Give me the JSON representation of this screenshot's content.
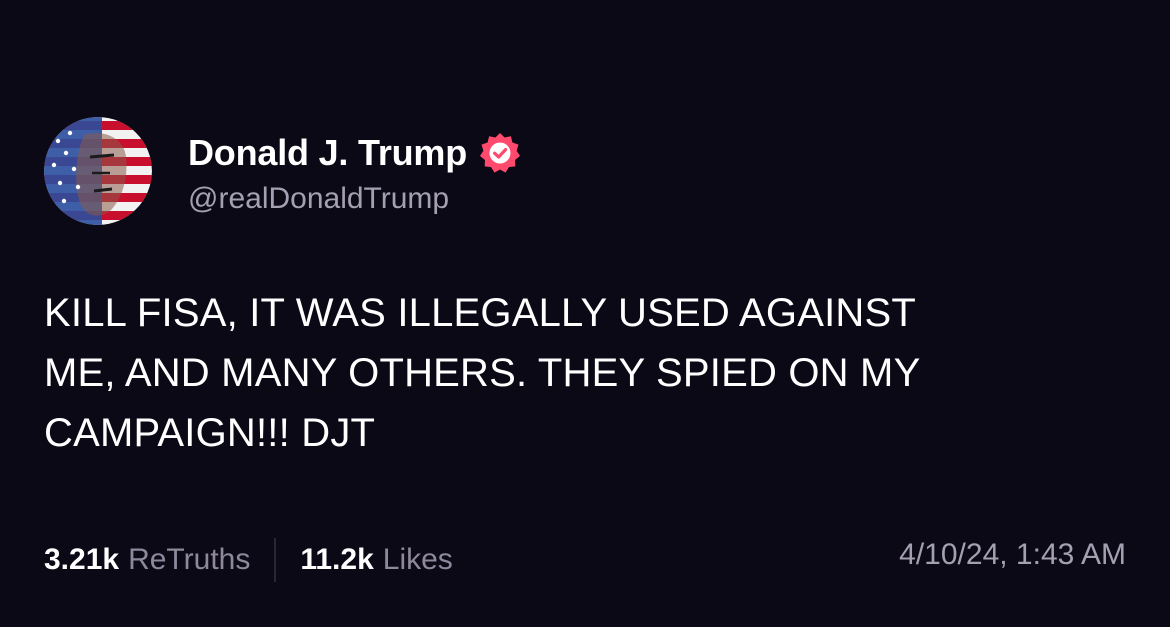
{
  "post": {
    "author": {
      "display_name": "Donald J. Trump",
      "handle": "@realDonaldTrump",
      "verified": true,
      "verified_badge_color": "#ff4a6e",
      "avatar": "flag-painted-portrait"
    },
    "text_lines": [
      "KILL FISA, IT WAS ILLEGALLY USED AGAINST",
      "ME, AND MANY OTHERS. THEY SPIED ON MY",
      "CAMPAIGN!!! DJT"
    ],
    "stats": {
      "retruths_count": "3.21k",
      "retruths_label": "ReTruths",
      "likes_count": "11.2k",
      "likes_label": "Likes"
    },
    "timestamp": "4/10/24, 1:43 AM"
  },
  "theme": {
    "background": "#0c0916",
    "text_primary": "#ffffff",
    "text_secondary": "#a4a0b2"
  }
}
